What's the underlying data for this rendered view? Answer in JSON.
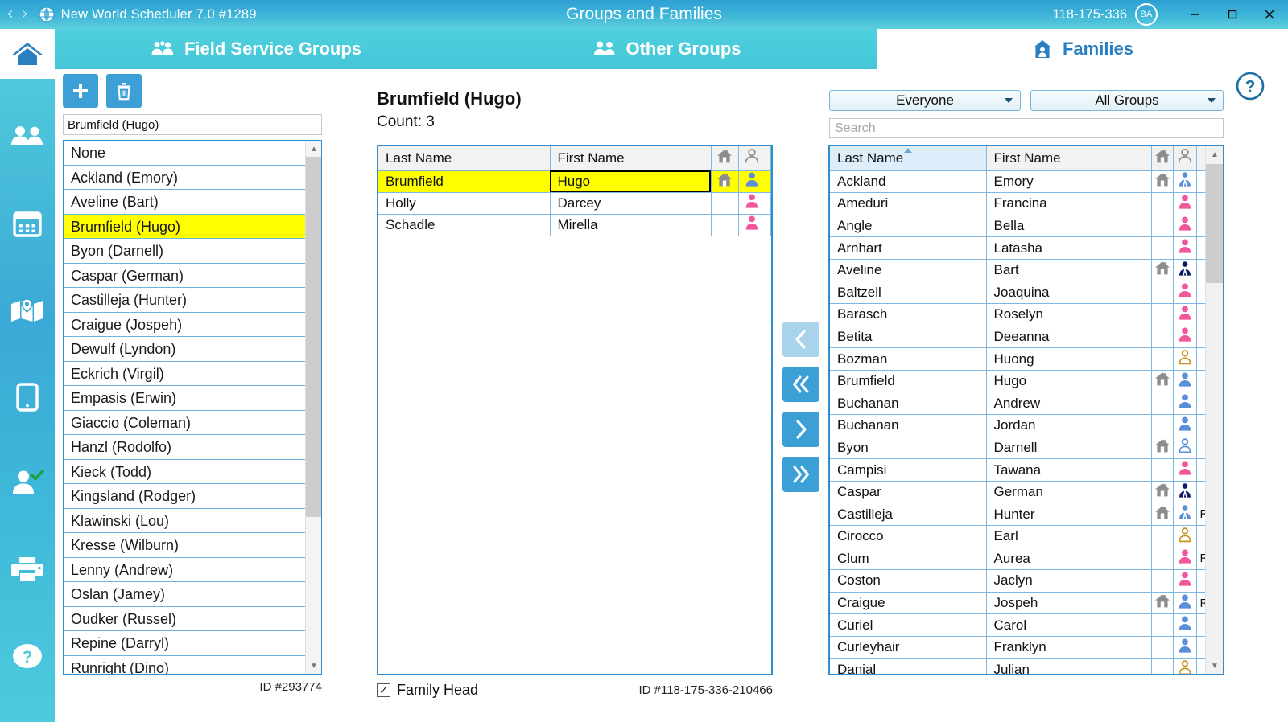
{
  "titlebar": {
    "back_arrow": "‹",
    "forward_arrow": "›",
    "app_title": "New World Scheduler  7.0 #1289",
    "window_title": "Groups and Families",
    "account_number": "118-175-336",
    "avatar_initials": "BA",
    "minimize": "–",
    "maximize": "☐",
    "close": "✕"
  },
  "tabs": [
    {
      "label": "Field Service Groups",
      "icon": "group-people-icon",
      "active": false
    },
    {
      "label": "Other Groups",
      "icon": "two-people-icon",
      "active": false
    },
    {
      "label": "Families",
      "icon": "house-family-icon",
      "active": true
    }
  ],
  "sidebar": {
    "items": [
      {
        "name": "home",
        "icon": "home-icon"
      },
      {
        "name": "publishers",
        "icon": "people-icon"
      },
      {
        "name": "calendar",
        "icon": "calendar-icon"
      },
      {
        "name": "territory-map",
        "icon": "map-icon"
      },
      {
        "name": "mobile",
        "icon": "tablet-icon"
      },
      {
        "name": "attendance",
        "icon": "person-check-icon"
      },
      {
        "name": "print",
        "icon": "printer-icon"
      },
      {
        "name": "help",
        "icon": "question-circle-icon"
      }
    ]
  },
  "left_panel": {
    "add_button": "add-icon",
    "delete_button": "trash-icon",
    "group_name_value": "Brumfield (Hugo)",
    "selected_item": "Brumfield (Hugo)",
    "items": [
      "None",
      "Ackland (Emory)",
      "Aveline (Bart)",
      "Brumfield (Hugo)",
      "Byon (Darnell)",
      "Caspar (German)",
      "Castilleja (Hunter)",
      "Craigue (Jospeh)",
      "Dewulf (Lyndon)",
      "Eckrich (Virgil)",
      "Empasis (Erwin)",
      "Giaccio (Coleman)",
      "Hanzl (Rodolfo)",
      "Kieck (Todd)",
      "Kingsland (Rodger)",
      "Klawinski (Lou)",
      "Kresse (Wilburn)",
      "Lenny (Andrew)",
      "Oslan (Jamey)",
      "Oudker (Russel)",
      "Repine (Darryl)",
      "Runright (Dino)"
    ],
    "id_label": "ID #293774"
  },
  "middle_panel": {
    "title": "Brumfield (Hugo)",
    "count_label": "Count: 3",
    "columns": [
      "Last Name",
      "First Name",
      "home-icon",
      "person-icon"
    ],
    "rows": [
      {
        "last": "Brumfield",
        "first": "Hugo",
        "home": true,
        "person": "blue-male",
        "selected": true
      },
      {
        "last": "Holly",
        "first": "Darcey",
        "home": false,
        "person": "pink-female",
        "selected": false
      },
      {
        "last": "Schadle",
        "first": "Mirella",
        "home": false,
        "person": "pink-female",
        "selected": false
      }
    ],
    "family_head_label": "Family Head",
    "family_head_checked": true,
    "id_label": "ID #118-175-336-210466"
  },
  "transfer_buttons": [
    {
      "name": "move-left-one",
      "glyph": "‹",
      "enabled": false
    },
    {
      "name": "move-left-all",
      "glyph": "«",
      "enabled": true
    },
    {
      "name": "move-right-one",
      "glyph": "›",
      "enabled": true
    },
    {
      "name": "move-right-all",
      "glyph": "»",
      "enabled": true
    }
  ],
  "right_panel": {
    "filter_people": "Everyone",
    "filter_groups": "All Groups",
    "search_placeholder": "Search",
    "search_value": "",
    "help_icon": "question-circle-icon",
    "columns": [
      "Last Name",
      "First Name",
      "home-icon",
      "person-icon",
      ""
    ],
    "sorted_column": "Last Name",
    "rows": [
      {
        "last": "Ackland",
        "first": "Emory",
        "home": true,
        "person": "blue-elder",
        "tag": ""
      },
      {
        "last": "Ameduri",
        "first": "Francina",
        "home": false,
        "person": "pink-female",
        "tag": ""
      },
      {
        "last": "Angle",
        "first": "Bella",
        "home": false,
        "person": "pink-female",
        "tag": ""
      },
      {
        "last": "Arnhart",
        "first": "Latasha",
        "home": false,
        "person": "pink-female",
        "tag": ""
      },
      {
        "last": "Aveline",
        "first": "Bart",
        "home": true,
        "person": "navy-elder",
        "tag": ""
      },
      {
        "last": "Baltzell",
        "first": "Joaquina",
        "home": false,
        "person": "pink-female",
        "tag": ""
      },
      {
        "last": "Barasch",
        "first": "Roselyn",
        "home": false,
        "person": "pink-female",
        "tag": ""
      },
      {
        "last": "Betita",
        "first": "Deeanna",
        "home": false,
        "person": "pink-female",
        "tag": ""
      },
      {
        "last": "Bozman",
        "first": "Huong",
        "home": false,
        "person": "gold-outline",
        "tag": ""
      },
      {
        "last": "Brumfield",
        "first": "Hugo",
        "home": true,
        "person": "blue-male",
        "tag": ""
      },
      {
        "last": "Buchanan",
        "first": "Andrew",
        "home": false,
        "person": "blue-male",
        "tag": ""
      },
      {
        "last": "Buchanan",
        "first": "Jordan",
        "home": false,
        "person": "blue-male",
        "tag": ""
      },
      {
        "last": "Byon",
        "first": "Darnell",
        "home": true,
        "person": "blue-outline",
        "tag": ""
      },
      {
        "last": "Campisi",
        "first": "Tawana",
        "home": false,
        "person": "pink-female",
        "tag": ""
      },
      {
        "last": "Caspar",
        "first": "German",
        "home": true,
        "person": "navy-elder",
        "tag": ""
      },
      {
        "last": "Castilleja",
        "first": "Hunter",
        "home": true,
        "person": "blue-elder",
        "tag": "RP"
      },
      {
        "last": "Cirocco",
        "first": "Earl",
        "home": false,
        "person": "gold-outline",
        "tag": ""
      },
      {
        "last": "Clum",
        "first": "Aurea",
        "home": false,
        "person": "pink-female",
        "tag": "RP"
      },
      {
        "last": "Coston",
        "first": "Jaclyn",
        "home": false,
        "person": "pink-female",
        "tag": ""
      },
      {
        "last": "Craigue",
        "first": "Jospeh",
        "home": true,
        "person": "blue-male",
        "tag": "RP"
      },
      {
        "last": "Curiel",
        "first": "Carol",
        "home": false,
        "person": "blue-male",
        "tag": ""
      },
      {
        "last": "Curleyhair",
        "first": "Franklyn",
        "home": false,
        "person": "blue-male",
        "tag": ""
      },
      {
        "last": "Danial",
        "first": "Julian",
        "home": false,
        "person": "gold-outline",
        "tag": ""
      }
    ]
  },
  "colors": {
    "brand_teal": "#4fd0dd",
    "brand_blue": "#3c9fd6",
    "selection_yellow": "#ffff00",
    "grid_border": "#2d8fd0",
    "male_blue": "#5b8fd9",
    "female_pink": "#f2569b",
    "elder_navy": "#0d1a66",
    "gold": "#c8931e"
  }
}
